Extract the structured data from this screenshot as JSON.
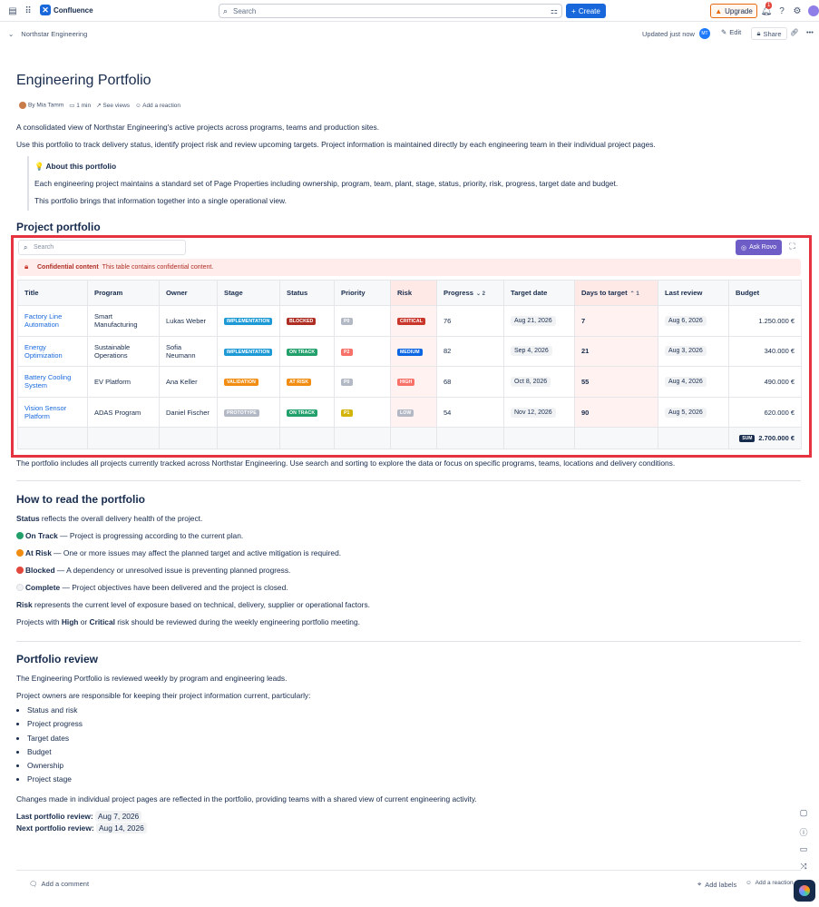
{
  "topbar": {
    "app_name": "Confluence",
    "search_placeholder": "Search",
    "create_label": "Create",
    "upgrade_label": "Upgrade",
    "notification_count": "1"
  },
  "page_header": {
    "breadcrumb": "Northstar Engineering",
    "updated": "Updated just now",
    "edit_label": "Edit",
    "share_label": "Share"
  },
  "page": {
    "title": "Engineering Portfolio",
    "author": "By Mia Tamm",
    "read_time": "1 min",
    "see_views": "See views",
    "add_reaction": "Add a reaction",
    "intro1": "A consolidated view of Northstar Engineering's active projects across programs, teams and production sites.",
    "intro2": "Use this portfolio to track delivery status, identify project risk and review upcoming targets. Project information is maintained directly by each engineering team in their individual project pages.",
    "panel_title": "💡 About this portfolio",
    "panel_p1": "Each engineering project maintains a standard set of Page Properties including ownership, program, team, plant, stage, status, priority, risk, progress, target date and budget.",
    "panel_p2": "This portfolio brings that information together into a single operational view.",
    "portfolio_heading": "Project portfolio"
  },
  "table": {
    "search_placeholder": "Search",
    "ask_rovo": "Ask Rovo",
    "conf_title": "Confidential content",
    "conf_msg": "This table contains confidential content.",
    "columns": [
      "Title",
      "Program",
      "Owner",
      "Stage",
      "Status",
      "Priority",
      "Risk",
      "Progress",
      "Target date",
      "Days to target",
      "Last review",
      "Budget"
    ],
    "progress_sort": "2",
    "days_sort": "1",
    "rows": [
      {
        "title": "Factory Line Automation",
        "program": "Smart Manufacturing",
        "owner": "Lukas Weber",
        "stage": "IMPLEMENTATION",
        "status": "BLOCKED",
        "priority": "P0",
        "risk": "CRITICAL",
        "progress": "76",
        "target": "Aug 21, 2026",
        "days": "7",
        "review": "Aug 6, 2026",
        "budget": "1.250.000 €"
      },
      {
        "title": "Energy Optimization",
        "program": "Sustainable Operations",
        "owner": "Sofia Neumann",
        "stage": "IMPLEMENTATION",
        "status": "ON TRACK",
        "priority": "P2",
        "risk": "MEDIUM",
        "progress": "82",
        "target": "Sep 4, 2026",
        "days": "21",
        "review": "Aug 3, 2026",
        "budget": "340.000 €"
      },
      {
        "title": "Battery Cooling System",
        "program": "EV Platform",
        "owner": "Ana Keller",
        "stage": "VALIDATION",
        "status": "AT RISK",
        "priority": "P0",
        "risk": "HIGH",
        "progress": "68",
        "target": "Oct 8, 2026",
        "days": "55",
        "review": "Aug 4, 2026",
        "budget": "490.000 €"
      },
      {
        "title": "Vision Sensor Platform",
        "program": "ADAS Program",
        "owner": "Daniel Fischer",
        "stage": "PROTOTYPE",
        "status": "ON TRACK",
        "priority": "P1",
        "risk": "LOW",
        "progress": "54",
        "target": "Nov 12, 2026",
        "days": "90",
        "review": "Aug 5, 2026",
        "budget": "620.000 €"
      }
    ],
    "sum_label": "SUM",
    "sum_value": "2.700.000 €"
  },
  "after_table": "The portfolio includes all projects currently tracked across Northstar Engineering. Use search and sorting to explore the data or focus on specific programs, teams, locations and delivery conditions.",
  "how_to": {
    "heading": "How to read the portfolio",
    "status_bold": "Status",
    "status_rest": " reflects the overall delivery health of the project.",
    "on_track_bold": "On Track",
    "on_track_rest": " — Project is progressing according to the current plan.",
    "at_risk_bold": "At Risk",
    "at_risk_rest": " — One or more issues may affect the planned target and active mitigation is required.",
    "blocked_bold": "Blocked",
    "blocked_rest": " — A dependency or unresolved issue is preventing planned progress.",
    "complete_bold": "Complete",
    "complete_rest": " — Project objectives have been delivered and the project is closed.",
    "risk_bold": "Risk",
    "risk_rest": " represents the current level of exposure based on technical, delivery, supplier or operational factors.",
    "projects_pre": "Projects with ",
    "high": "High",
    "or": " or ",
    "critical": "Critical",
    "projects_post": " risk should be reviewed during the weekly engineering portfolio meeting."
  },
  "review": {
    "heading": "Portfolio review",
    "p1": "The Engineering Portfolio is reviewed weekly by program and engineering leads.",
    "p2": "Project owners are responsible for keeping their project information current, particularly:",
    "items": [
      "Status and risk",
      "Project progress",
      "Target dates",
      "Budget",
      "Ownership",
      "Project stage"
    ],
    "p3": "Changes made in individual project pages are reflected in the portfolio, providing teams with a shared view of current engineering activity.",
    "last_label": "Last portfolio review:",
    "last_date": "Aug 7, 2026",
    "next_label": "Next portfolio review:",
    "next_date": "Aug 14, 2026"
  },
  "footer": {
    "add_comment": "Add a comment",
    "add_labels": "Add labels",
    "add_reaction": "Add a reaction"
  },
  "colors": {
    "accent": "#1868db",
    "highlight_frame": "#e5333f",
    "rovo": "#6e5dc6"
  }
}
